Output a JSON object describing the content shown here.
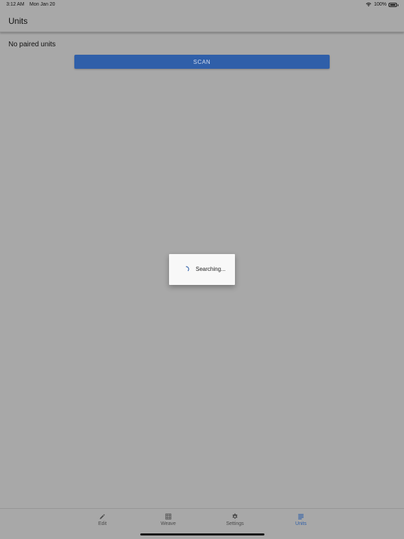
{
  "status_bar": {
    "time": "3:12 AM",
    "date": "Mon Jan 20",
    "battery": "100%"
  },
  "app_bar": {
    "title": "Units"
  },
  "content": {
    "empty_message": "No paired units",
    "scan_label": "SCAN"
  },
  "dialog": {
    "message": "Searching..."
  },
  "tab_bar": {
    "items": [
      {
        "label": "Edit",
        "icon": "pencil-icon"
      },
      {
        "label": "Weave",
        "icon": "grid-icon"
      },
      {
        "label": "Settings",
        "icon": "gear-icon"
      },
      {
        "label": "Units",
        "icon": "list-icon",
        "active": true
      }
    ]
  },
  "colors": {
    "accent": "#2f5fa9",
    "overlay_background": "#a8a8a8"
  }
}
